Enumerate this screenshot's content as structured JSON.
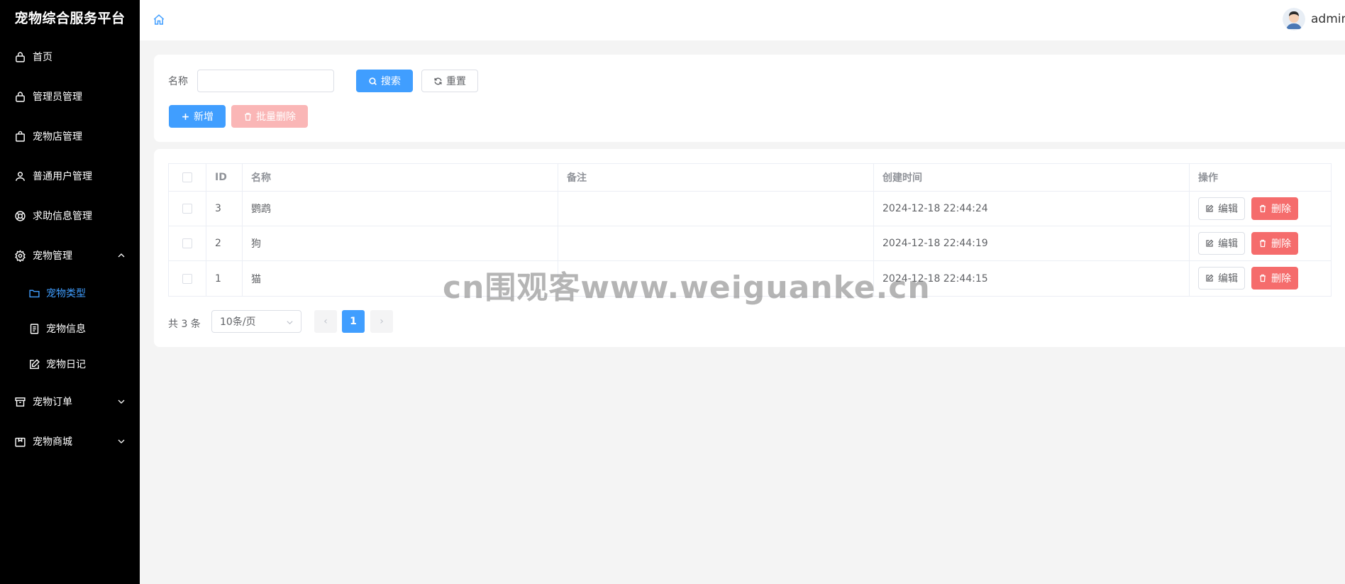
{
  "brand": "宠物综合服务平台",
  "sidebar": {
    "items": [
      {
        "label": "首页"
      },
      {
        "label": "管理员管理"
      },
      {
        "label": "宠物店管理"
      },
      {
        "label": "普通用户管理"
      },
      {
        "label": "求助信息管理"
      },
      {
        "label": "宠物管理"
      },
      {
        "label": "宠物订单"
      },
      {
        "label": "宠物商城"
      }
    ],
    "subitems": [
      {
        "label": "宠物类型",
        "active": true
      },
      {
        "label": "宠物信息"
      },
      {
        "label": "宠物日记"
      }
    ]
  },
  "header": {
    "username": "admin"
  },
  "search": {
    "name_label": "名称",
    "name_value": "",
    "search_label": "搜索",
    "reset_label": "重置",
    "add_label": "新增",
    "batch_delete_label": "批量删除"
  },
  "table": {
    "columns": [
      "ID",
      "名称",
      "备注",
      "创建时间",
      "操作"
    ],
    "rows": [
      {
        "id": "3",
        "name": "鹦鹉",
        "note": "",
        "created": "2024-12-18 22:44:24"
      },
      {
        "id": "2",
        "name": "狗",
        "note": "",
        "created": "2024-12-18 22:44:19"
      },
      {
        "id": "1",
        "name": "猫",
        "note": "",
        "created": "2024-12-18 22:44:15"
      }
    ],
    "edit_label": "编辑",
    "delete_label": "删除"
  },
  "pagination": {
    "total_text": "共 3 条",
    "page_size": "10条/页",
    "current_page": "1",
    "prev": "‹",
    "next": "›"
  },
  "watermark": "cn围观客www.weiguanke.cn",
  "colors": {
    "primary": "#409eff",
    "danger": "#f56c6c",
    "sidebar_bg": "#000000",
    "page_bg": "#f4f4f4"
  }
}
